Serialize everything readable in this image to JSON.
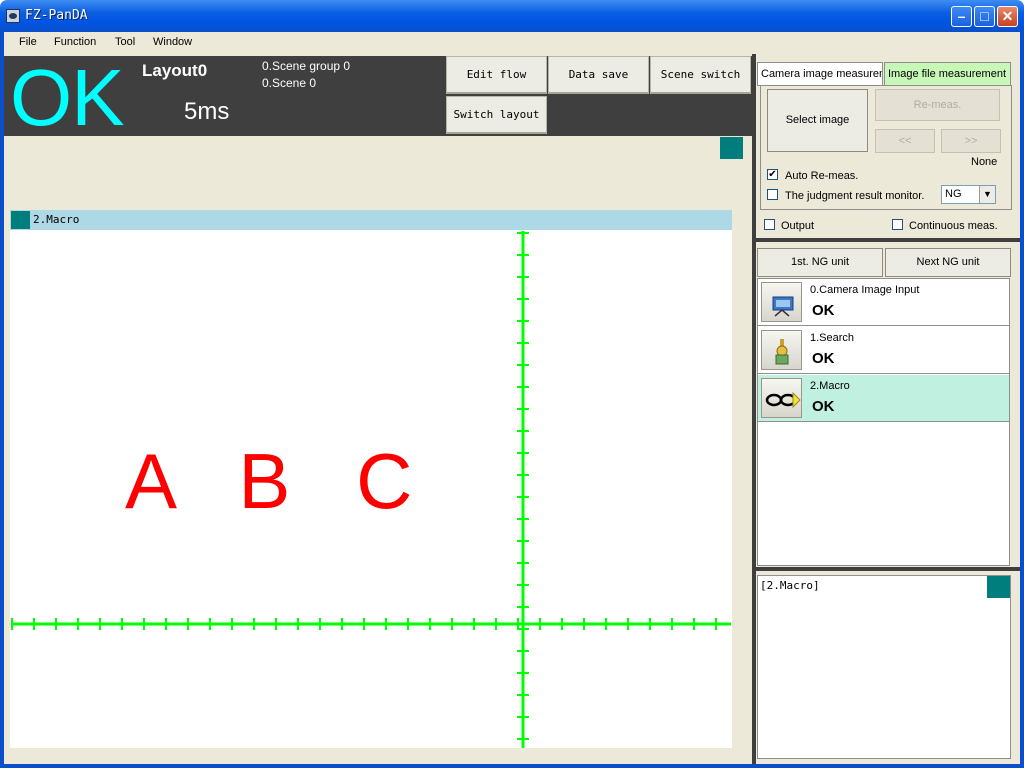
{
  "window": {
    "title": "FZ-PanDA"
  },
  "menu": [
    "File",
    "Function",
    "Tool",
    "Window"
  ],
  "status": {
    "judgement": "OK",
    "layout": "Layout0",
    "time": "5ms",
    "scene_group": "0.Scene group 0",
    "scene": "0.Scene 0"
  },
  "toolbar": {
    "edit_flow": "Edit flow",
    "data_save": "Data save",
    "scene_switch": "Scene switch",
    "switch_layout": "Switch layout"
  },
  "image_window": {
    "title": "2.Macro",
    "text": "A B C",
    "text_color": "#ff0000",
    "crosshair_color": "#00ff00"
  },
  "right_panel": {
    "tabs": [
      "Camera image measurement",
      "Image file measurement"
    ],
    "active_tab": "Image file measurement",
    "select_image": "Select image",
    "re_meas": "Re-meas.",
    "prev": "<<",
    "next": ">>",
    "file_name": "None",
    "auto_remeas": {
      "label": "Auto Re-meas.",
      "checked": true
    },
    "judgment_monitor": {
      "label": "The judgment result monitor.",
      "checked": false,
      "value": "NG"
    },
    "output": {
      "label": "Output",
      "checked": false
    },
    "continuous": {
      "label": "Continuous meas.",
      "checked": false
    },
    "first_ng": "1st. NG unit",
    "next_ng": "Next NG unit"
  },
  "units": [
    {
      "name": "0.Camera Image Input",
      "result": "OK",
      "icon": "camera-icon"
    },
    {
      "name": "1.Search",
      "result": "OK",
      "icon": "search-icon"
    },
    {
      "name": "2.Macro",
      "result": "OK",
      "icon": "macro-glasses-icon"
    }
  ],
  "detail": {
    "title": "[2.Macro]"
  },
  "colors": {
    "ok": "#00ffff",
    "header_bg": "#3f3f3f",
    "selected_row": "#c0f0e0",
    "active_tab": "#c8f8b8"
  }
}
